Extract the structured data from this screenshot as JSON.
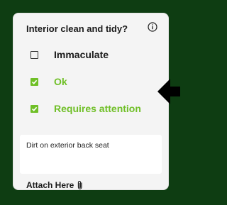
{
  "card": {
    "question": "Interior clean and tidy?",
    "info_icon": "info-circle-icon",
    "options": [
      {
        "label": "Immaculate",
        "checked": false
      },
      {
        "label": "Ok",
        "checked": true
      },
      {
        "label": "Requires attention",
        "checked": true
      }
    ],
    "notes_value": "Dirt on exterior back seat",
    "attach_label": "Attach Here",
    "attach_icon": "paperclip-icon"
  },
  "colors": {
    "background": "#0e3d12",
    "card": "#f4f4f4",
    "accent": "#6fbf26",
    "text": "#1a1a1a"
  }
}
